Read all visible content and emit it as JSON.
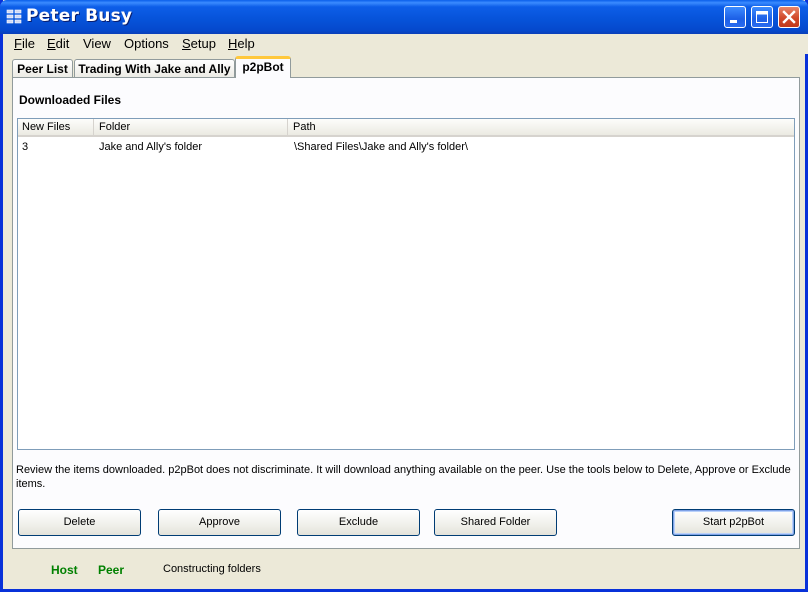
{
  "window": {
    "title": "Peter Busy"
  },
  "menu": [
    {
      "label": "File",
      "mnemonic": "F",
      "rest": "ile"
    },
    {
      "label": "Edit",
      "mnemonic": "E",
      "rest": "dit"
    },
    {
      "label": "View",
      "mnemonic": "",
      "rest": "View"
    },
    {
      "label": "Options",
      "mnemonic": "",
      "rest": "Options"
    },
    {
      "label": "Setup",
      "mnemonic": "S",
      "rest": "etup"
    },
    {
      "label": "Help",
      "mnemonic": "H",
      "rest": "elp"
    }
  ],
  "tabs": [
    {
      "label": "Peer List",
      "active": false
    },
    {
      "label": "Trading With Jake and Ally",
      "active": false
    },
    {
      "label": "p2pBot",
      "active": true
    }
  ],
  "section": {
    "title": "Downloaded Files"
  },
  "table": {
    "columns": [
      "New Files",
      "Folder",
      "Path"
    ],
    "rows": [
      [
        "3",
        "Jake and Ally's folder",
        "\\Shared Files\\Jake and Ally's folder\\"
      ]
    ]
  },
  "description": "Review the items downloaded. p2pBot does not discriminate. It will download anything available on the peer. Use the tools below to Delete, Approve or Exclude items.",
  "buttons": {
    "delete": "Delete",
    "approve": "Approve",
    "exclude": "Exclude",
    "shared_folder": "Shared Folder",
    "start": "Start p2pBot"
  },
  "status": {
    "host": "Host",
    "peer": "Peer",
    "message": "Constructing folders"
  },
  "colors": {
    "status_green": "#008000",
    "titlebar_blue": "#0652d8",
    "active_tab_accent": "#ffc83c"
  }
}
